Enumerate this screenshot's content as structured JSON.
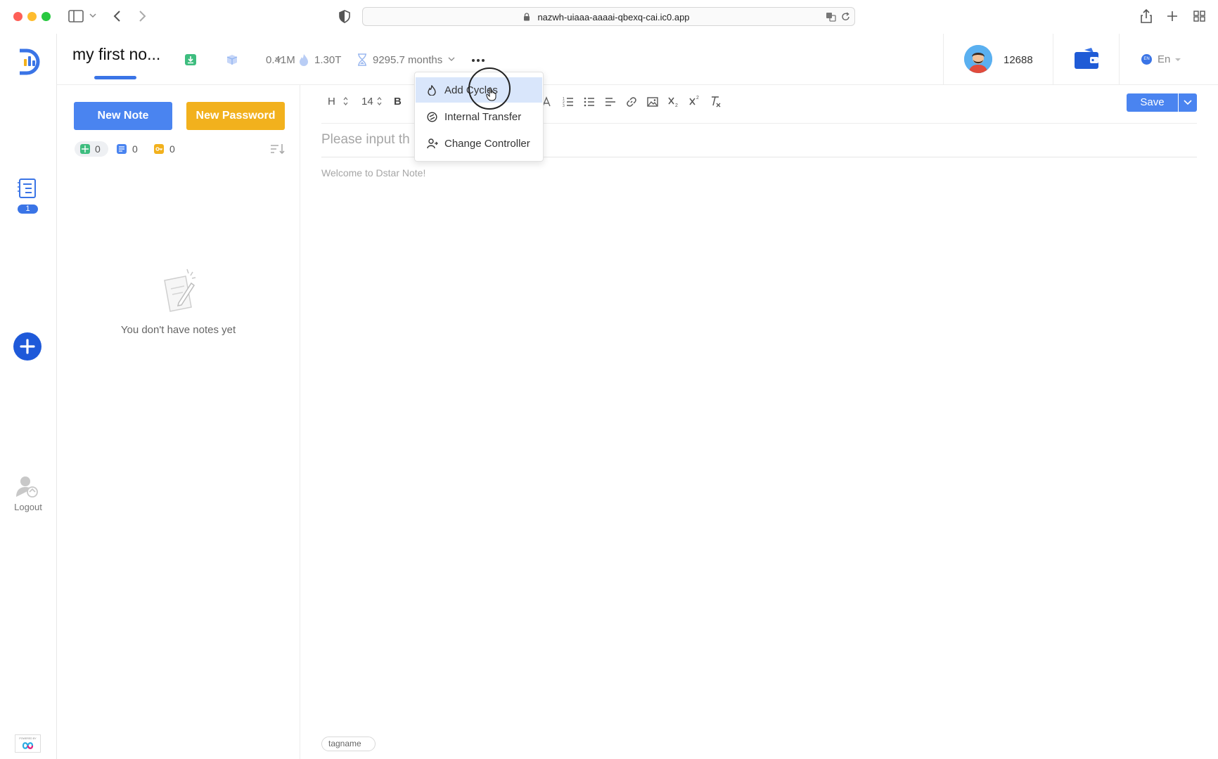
{
  "browser": {
    "url": "nazwh-uiaaa-aaaai-qbexq-cai.ic0.app",
    "colors": {
      "close": "#fe5f57",
      "minimize": "#febc2e",
      "maximize": "#28c840"
    }
  },
  "rail": {
    "notes_badge": "1",
    "logout_label": "Logout",
    "accent": "#3a74e6"
  },
  "header": {
    "note_title": "my first no...",
    "memory": "0.41M",
    "cycles": "1.30T",
    "duration": "9295.7 months",
    "balance": "12688",
    "language": "En",
    "language_badge": "EN"
  },
  "sidebar": {
    "new_note_label": "New Note",
    "new_password_label": "New Password",
    "counts": {
      "all": "0",
      "notes": "0",
      "passwords": "0"
    },
    "empty_text": "You don't have notes yet"
  },
  "editor": {
    "heading_select": "H",
    "font_size": "14",
    "bold": "B",
    "title_placeholder": "Please input th",
    "body_placeholder": "Welcome to Dstar Note!",
    "save_label": "Save",
    "tag_placeholder": "tagname"
  },
  "menu": {
    "items": [
      {
        "label": "Add Cycles",
        "icon": "fire-icon"
      },
      {
        "label": "Internal Transfer",
        "icon": "transfer-icon"
      },
      {
        "label": "Change Controller",
        "icon": "user-swap-icon"
      }
    ],
    "highlight": "#d9e6fb"
  }
}
